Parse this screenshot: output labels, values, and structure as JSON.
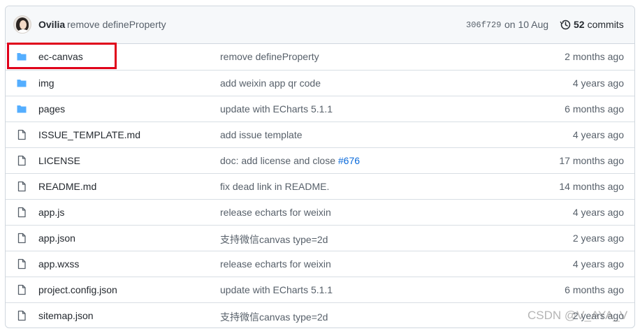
{
  "commit": {
    "author": "Ovilia",
    "message": "remove defineProperty",
    "sha": "306f729",
    "date": "on 10 Aug",
    "commit_count": "52",
    "commit_label": "commits"
  },
  "files": [
    {
      "type": "folder",
      "name": "ec-canvas",
      "message": "remove defineProperty",
      "age": "2 months ago"
    },
    {
      "type": "folder",
      "name": "img",
      "message": "add weixin app qr code",
      "age": "4 years ago"
    },
    {
      "type": "folder",
      "name": "pages",
      "message": "update with ECharts 5.1.1",
      "age": "6 months ago"
    },
    {
      "type": "file",
      "name": "ISSUE_TEMPLATE.md",
      "message": "add issue template",
      "age": "4 years ago"
    },
    {
      "type": "file",
      "name": "LICENSE",
      "message": "doc: add license and close",
      "message_link": "#676",
      "age": "17 months ago"
    },
    {
      "type": "file",
      "name": "README.md",
      "message": "fix dead link in README.",
      "age": "14 months ago"
    },
    {
      "type": "file",
      "name": "app.js",
      "message": "release echarts for weixin",
      "age": "4 years ago"
    },
    {
      "type": "file",
      "name": "app.json",
      "message": "支持微信canvas type=2d",
      "age": "2 years ago"
    },
    {
      "type": "file",
      "name": "app.wxss",
      "message": "release echarts for weixin",
      "age": "4 years ago"
    },
    {
      "type": "file",
      "name": "project.config.json",
      "message": "update with ECharts 5.1.1",
      "age": "6 months ago"
    },
    {
      "type": "file",
      "name": "sitemap.json",
      "message": "支持微信canvas type=2d",
      "age": "2 years ago"
    }
  ],
  "watermark": "CSDN @V_AYA_V",
  "colors": {
    "folder": "#54aeff",
    "file": "#57606a",
    "link": "#0969da",
    "highlight": "#e0001a"
  }
}
